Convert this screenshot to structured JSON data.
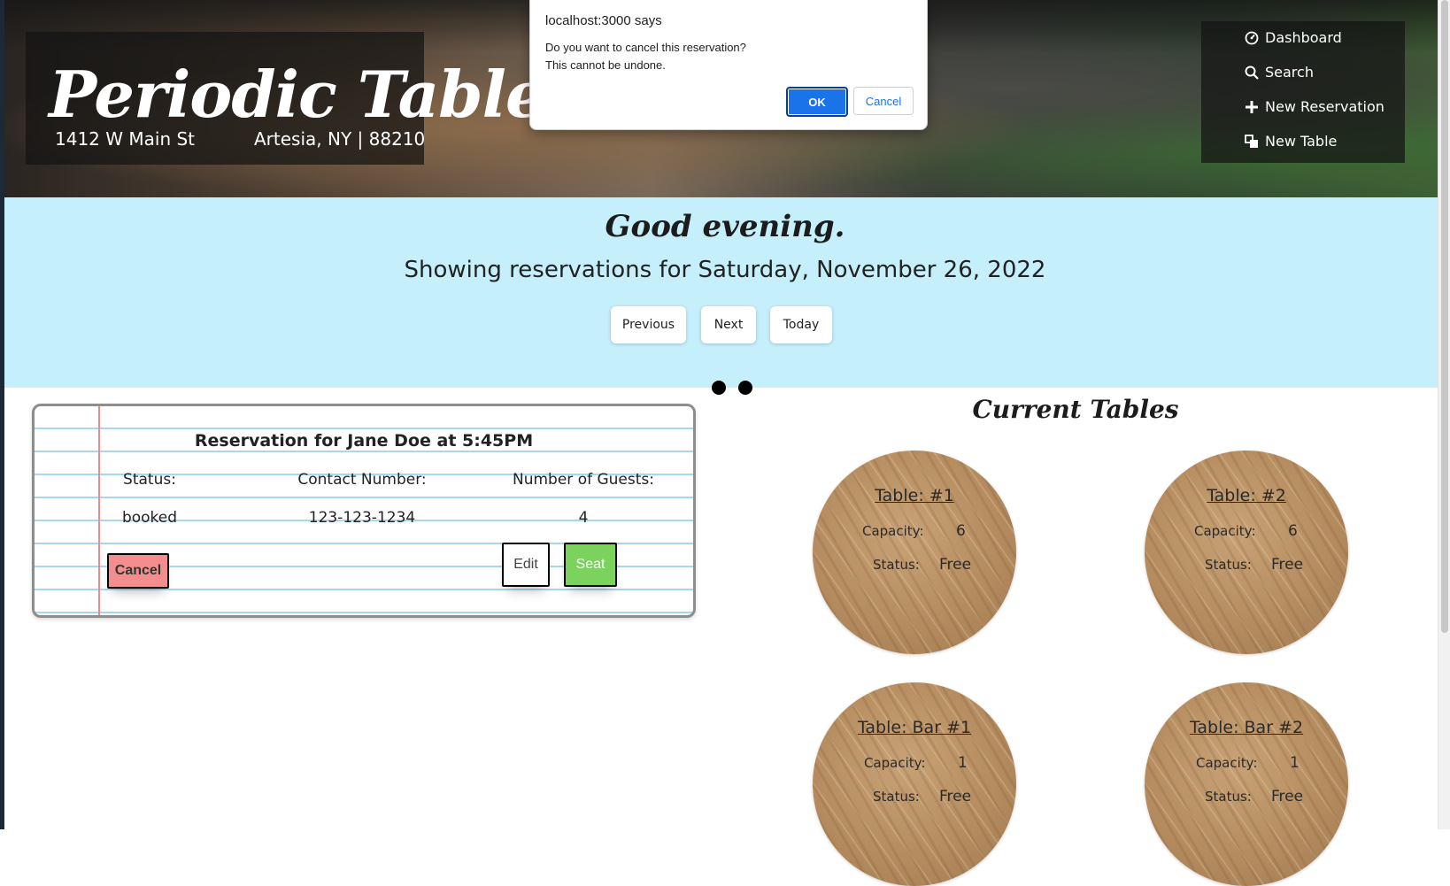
{
  "header": {
    "brand_title": "Periodic Tables",
    "address_street": "1412 W Main St",
    "address_city": "Artesia, NY | 88210",
    "nav": [
      {
        "label": "Dashboard",
        "icon": "dashboard-icon"
      },
      {
        "label": "Search",
        "icon": "search-icon"
      },
      {
        "label": "New Reservation",
        "icon": "plus-icon"
      },
      {
        "label": "New Table",
        "icon": "table-icon"
      }
    ]
  },
  "dialog": {
    "title": "localhost:3000 says",
    "message_line1": "Do you want to cancel this reservation?",
    "message_line2": "This cannot be undone.",
    "ok_label": "OK",
    "cancel_label": "Cancel"
  },
  "dashboard": {
    "greeting": "Good evening.",
    "date_line": "Showing reservations for Saturday, November 26, 2022",
    "buttons": {
      "previous": "Previous",
      "next": "Next",
      "today": "Today"
    }
  },
  "reservation": {
    "title": "Reservation for Jane Doe at 5:45PM",
    "status_label": "Status:",
    "status_value": "booked",
    "contact_label": "Contact Number:",
    "contact_value": "123-123-1234",
    "guests_label": "Number of Guests:",
    "guests_value": "4",
    "cancel_label": "Cancel",
    "edit_label": "Edit",
    "seat_label": "Seat"
  },
  "tables": {
    "title": "Current Tables",
    "capacity_label": "Capacity:",
    "status_label": "Status:",
    "items": [
      {
        "name": "Table: #1",
        "capacity": "6",
        "status": "Free"
      },
      {
        "name": "Table: #2",
        "capacity": "6",
        "status": "Free"
      },
      {
        "name": "Table: Bar #1",
        "capacity": "1",
        "status": "Free"
      },
      {
        "name": "Table: Bar #2",
        "capacity": "1",
        "status": "Free"
      }
    ]
  },
  "colors": {
    "band": "#c6effc",
    "seat_button": "#7bd35e",
    "cancel_button": "#f48e8e",
    "dialog_ok": "#1a73e8"
  }
}
